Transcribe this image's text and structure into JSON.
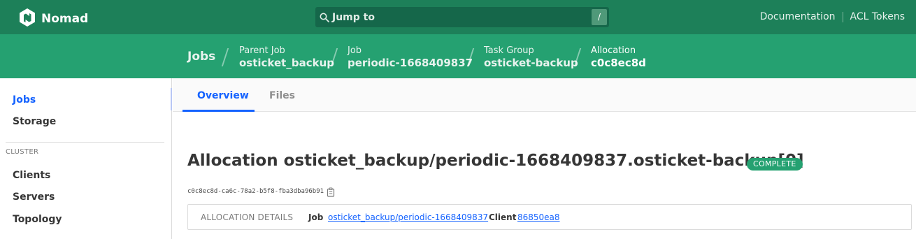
{
  "topbar": {
    "brand": "Nomad",
    "search_placeholder": "Jump to",
    "search_shortcut": "/",
    "links": [
      "Documentation",
      "ACL Tokens"
    ]
  },
  "breadcrumbs": {
    "root": "Jobs",
    "items": [
      {
        "label": "Parent Job",
        "value": "osticket_backup"
      },
      {
        "label": "Job",
        "value": "periodic-1668409837"
      },
      {
        "label": "Task Group",
        "value": "osticket-backup"
      },
      {
        "label": "Allocation",
        "value": "c0c8ec8d"
      }
    ]
  },
  "sidebar": {
    "items": [
      "Jobs",
      "Storage"
    ],
    "cluster_heading": "CLUSTER",
    "cluster_items": [
      "Clients",
      "Servers",
      "Topology"
    ]
  },
  "tabs": [
    "Overview",
    "Files"
  ],
  "allocation": {
    "title": "Allocation osticket_backup/periodic-1668409837.osticket-backup[0]",
    "status": "COMPLETE",
    "id": "c0c8ec8d-ca6c-78a2-b5f8-fba3dba96b91"
  },
  "details": {
    "heading": "ALLOCATION DETAILS",
    "job_label": "Job",
    "job_value": "osticket_backup/periodic-1668409837",
    "client_label": "Client",
    "client_value": "86850ea8"
  },
  "colors": {
    "topbar": "#1d8059",
    "breadcrumb_bar": "#25a171",
    "accent": "#1563ff",
    "status_badge": "#25a171"
  },
  "icons": [
    "nomad-logo-icon",
    "search-icon",
    "copy-icon"
  ]
}
